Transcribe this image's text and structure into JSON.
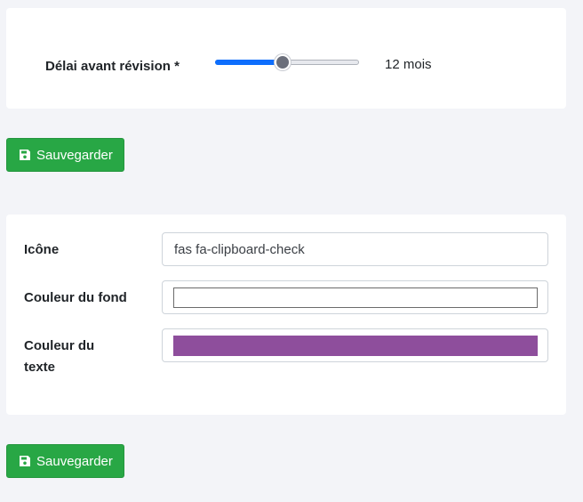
{
  "revision": {
    "label": "Délai avant révision *",
    "slider_fraction": 0.47,
    "value_text": "12 mois"
  },
  "buttons": {
    "save_label": "Sauvegarder",
    "save_icon": "floppy-disk-icon"
  },
  "appearance": {
    "icon_label": "Icône",
    "icon_value": "fas fa-clipboard-check",
    "background_label": "Couleur du fond",
    "background_color": "#ffffff",
    "text_label": "Couleur du texte",
    "text_color": "#8e4e9c"
  },
  "colors": {
    "accent": "#0d6efd",
    "success": "#28a745",
    "page_bg": "#f3f4f8"
  }
}
